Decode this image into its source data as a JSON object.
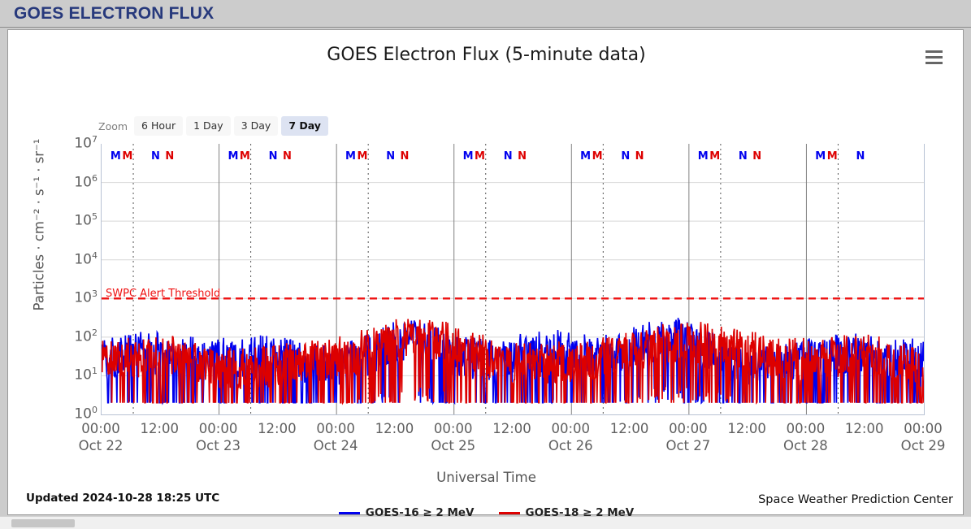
{
  "header": {
    "title": "GOES ELECTRON FLUX",
    "accent_color": "#27397c"
  },
  "menu": {
    "icon": "hamburger-icon"
  },
  "zoom_control": {
    "label": "Zoom",
    "options": [
      {
        "label": "6 Hour",
        "active": false
      },
      {
        "label": "1 Day",
        "active": false
      },
      {
        "label": "3 Day",
        "active": false
      },
      {
        "label": "7 Day",
        "active": true
      }
    ]
  },
  "footer": {
    "updated": "Updated 2024-10-28 18:25 UTC",
    "credit": "Space Weather Prediction Center"
  },
  "chart_data": {
    "type": "line",
    "title": "GOES Electron Flux (5-minute data)",
    "xlabel": "Universal Time",
    "ylabel": "Particles · cm⁻² · s⁻¹ · sr⁻¹",
    "yscale": "log",
    "ylim": [
      1,
      10000000
    ],
    "ytick_labels": [
      "10⁷",
      "10⁶",
      "10⁵",
      "10⁴",
      "10³",
      "10²",
      "10¹",
      "10⁰"
    ],
    "ytick_values": [
      10000000,
      1000000,
      100000,
      10000,
      1000,
      100,
      10,
      1
    ],
    "grid": true,
    "legend_position": "bottom-center",
    "x_range_start": "Oct 22 00:00",
    "x_range_end": "Oct 29 00:00",
    "xtick_labels": [
      {
        "time": "00:00",
        "date": "Oct 22"
      },
      {
        "time": "12:00",
        "date": ""
      },
      {
        "time": "00:00",
        "date": "Oct 23"
      },
      {
        "time": "12:00",
        "date": ""
      },
      {
        "time": "00:00",
        "date": "Oct 24"
      },
      {
        "time": "12:00",
        "date": ""
      },
      {
        "time": "00:00",
        "date": "Oct 25"
      },
      {
        "time": "12:00",
        "date": ""
      },
      {
        "time": "00:00",
        "date": "Oct 26"
      },
      {
        "time": "12:00",
        "date": ""
      },
      {
        "time": "00:00",
        "date": "Oct 27"
      },
      {
        "time": "12:00",
        "date": ""
      },
      {
        "time": "00:00",
        "date": "Oct 28"
      },
      {
        "time": "12:00",
        "date": ""
      },
      {
        "time": "00:00",
        "date": "Oct 29"
      }
    ],
    "threshold": {
      "label": "SWPC Alert Threshold",
      "value": 1000,
      "color": "#ee1111",
      "style": "dashed"
    },
    "series": [
      {
        "name": "GOES-16 ≥ 2 MeV",
        "color": "#0000ee",
        "satellite": "GOES-16",
        "energy": "≥ 2 MeV"
      },
      {
        "name": "GOES-18 ≥ 2 MeV",
        "color": "#dd0000",
        "satellite": "GOES-18",
        "energy": "≥ 2 MeV"
      }
    ],
    "markers": {
      "note": "Daily magnetopause (M) and neutral point (N) crossing markers, one blue (GOES-16) and one red (GOES-18) each",
      "letters": [
        "M",
        "M",
        "N",
        "N"
      ],
      "colors": [
        "#0000ee",
        "#dd0000",
        "#0000ee",
        "#dd0000"
      ],
      "days": 7
    },
    "flux_range_observed": {
      "min": 2,
      "max": 320
    }
  }
}
